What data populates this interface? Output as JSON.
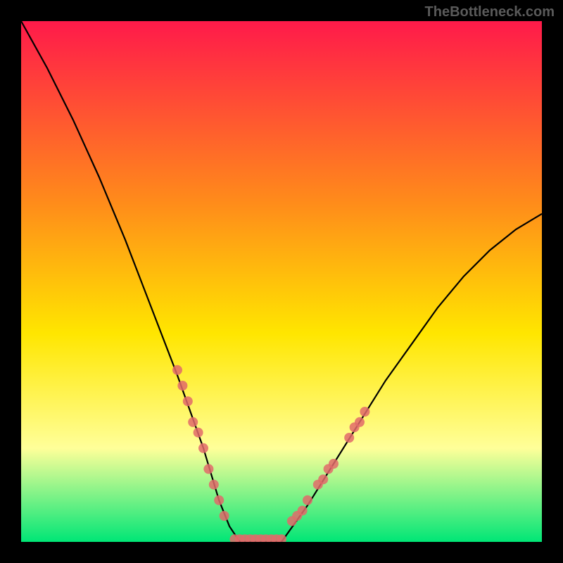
{
  "watermark": "TheBottleneck.com",
  "chart_data": {
    "type": "line",
    "title": "",
    "xlabel": "",
    "ylabel": "",
    "xlim": [
      0,
      100
    ],
    "ylim": [
      0,
      100
    ],
    "background_gradient": {
      "top": "#ff1a4a",
      "mid_upper": "#ff8c1a",
      "mid": "#ffe600",
      "mid_lower": "#ffff99",
      "bottom": "#00e676"
    },
    "series": [
      {
        "name": "bottleneck-curve",
        "color": "#000000",
        "x": [
          0,
          5,
          10,
          15,
          20,
          25,
          30,
          35,
          38,
          40,
          42,
          44,
          46,
          48,
          50,
          55,
          60,
          65,
          70,
          75,
          80,
          85,
          90,
          95,
          100
        ],
        "y": [
          100,
          91,
          81,
          70,
          58,
          45,
          32,
          18,
          8,
          3,
          0,
          0,
          0,
          0,
          0,
          7,
          15,
          23,
          31,
          38,
          45,
          51,
          56,
          60,
          63
        ]
      }
    ],
    "marker_clusters": [
      {
        "name": "left-cluster",
        "color": "#e26a6a",
        "points": [
          {
            "x": 30,
            "y": 33
          },
          {
            "x": 31,
            "y": 30
          },
          {
            "x": 32,
            "y": 27
          },
          {
            "x": 33,
            "y": 23
          },
          {
            "x": 34,
            "y": 21
          },
          {
            "x": 35,
            "y": 18
          },
          {
            "x": 36,
            "y": 14
          },
          {
            "x": 37,
            "y": 11
          },
          {
            "x": 38,
            "y": 8
          },
          {
            "x": 39,
            "y": 5
          }
        ]
      },
      {
        "name": "bottom-cluster",
        "color": "#e26a6a",
        "points": [
          {
            "x": 41,
            "y": 0.5
          },
          {
            "x": 42,
            "y": 0.5
          },
          {
            "x": 43,
            "y": 0.5
          },
          {
            "x": 44,
            "y": 0.5
          },
          {
            "x": 45,
            "y": 0.5
          },
          {
            "x": 46,
            "y": 0.5
          },
          {
            "x": 47,
            "y": 0.5
          },
          {
            "x": 48,
            "y": 0.5
          },
          {
            "x": 49,
            "y": 0.5
          },
          {
            "x": 50,
            "y": 0.5
          }
        ]
      },
      {
        "name": "right-cluster",
        "color": "#e26a6a",
        "points": [
          {
            "x": 52,
            "y": 4
          },
          {
            "x": 53,
            "y": 5
          },
          {
            "x": 54,
            "y": 6
          },
          {
            "x": 55,
            "y": 8
          },
          {
            "x": 57,
            "y": 11
          },
          {
            "x": 58,
            "y": 12
          },
          {
            "x": 59,
            "y": 14
          },
          {
            "x": 60,
            "y": 15
          },
          {
            "x": 63,
            "y": 20
          },
          {
            "x": 64,
            "y": 22
          },
          {
            "x": 65,
            "y": 23
          },
          {
            "x": 66,
            "y": 25
          }
        ]
      }
    ]
  }
}
